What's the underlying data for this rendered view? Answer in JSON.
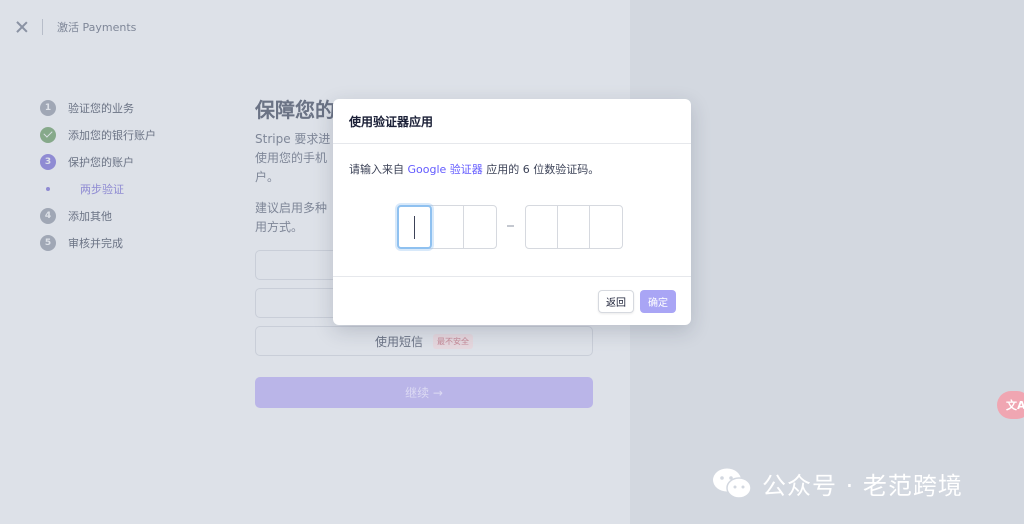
{
  "topbar": {
    "title": "激活 Payments"
  },
  "steps": [
    {
      "num": "1",
      "label": "验证您的业务"
    },
    {
      "num": "",
      "label": "添加您的银行账户"
    },
    {
      "num": "3",
      "label": "保护您的账户"
    },
    {
      "num": "",
      "label": "两步验证"
    },
    {
      "num": "4",
      "label": "添加其他"
    },
    {
      "num": "5",
      "label": "审核并完成"
    }
  ],
  "main": {
    "heading": "保障您的账户安全",
    "para1_l1": "Stripe 要求进",
    "para1_l2": "使用您的手机",
    "para1_l3": "户。",
    "para2_l1": "建议启用多种",
    "para2_l2": "用方式。",
    "sms_label": "使用短信",
    "sms_badge": "最不安全",
    "continue_label": "继续 →"
  },
  "dialog": {
    "title": "使用验证器应用",
    "desc_pre": "请输入来自",
    "desc_link": "Google 验证器",
    "desc_post": "应用的 6 位数验证码。",
    "back_label": "返回",
    "confirm_label": "确定"
  },
  "fab": {
    "label": "文A"
  },
  "watermark": {
    "text": "公众号 · 老范跨境"
  },
  "colors": {
    "accent": "#635bff",
    "danger_badge": "#c58a97"
  }
}
